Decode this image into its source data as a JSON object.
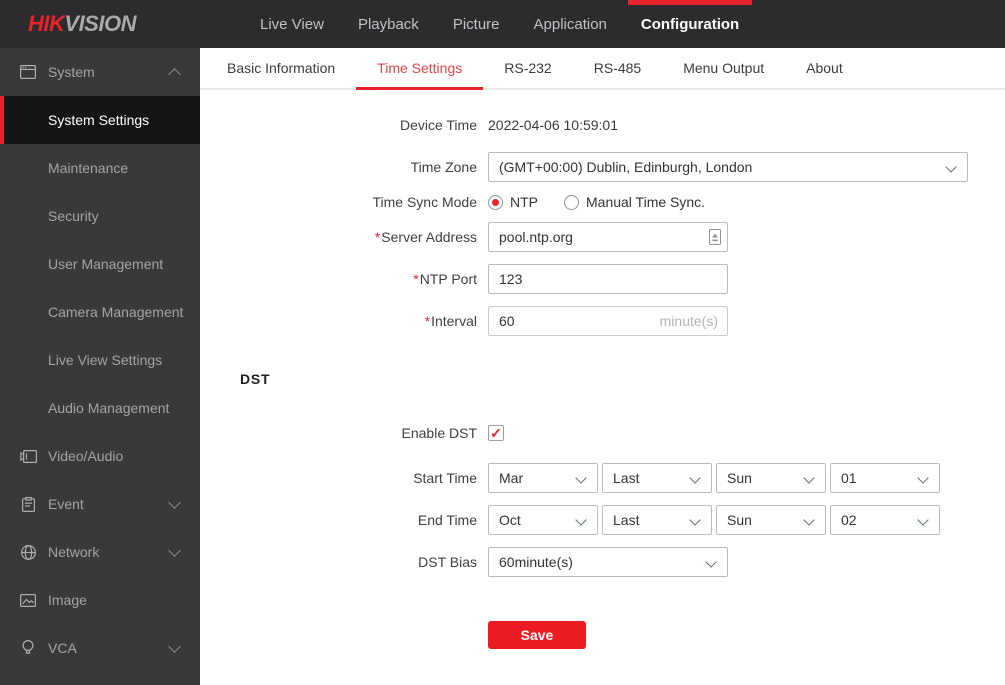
{
  "colors": {
    "accent_red": "#e8232b",
    "save_button_red": "#ed1c24",
    "topbar_bg": "#2c2c2e",
    "sidebar_bg": "#39393b",
    "active_sidebar_bg": "#151515",
    "active_tab_text": "#e24343"
  },
  "topbar": {
    "logo_hik": "HIK",
    "logo_vision": "VISION",
    "nav": [
      {
        "label": "Live View"
      },
      {
        "label": "Playback"
      },
      {
        "label": "Picture"
      },
      {
        "label": "Application"
      },
      {
        "label": "Configuration",
        "active": true
      }
    ]
  },
  "sidebar": {
    "items": [
      {
        "label": "System",
        "type": "group",
        "icon": "system-icon",
        "chevron": "up",
        "expanded": true
      },
      {
        "label": "System Settings",
        "type": "sub",
        "active": true
      },
      {
        "label": "Maintenance",
        "type": "sub"
      },
      {
        "label": "Security",
        "type": "sub"
      },
      {
        "label": "User Management",
        "type": "sub"
      },
      {
        "label": "Camera Management",
        "type": "sub"
      },
      {
        "label": "Live View Settings",
        "type": "sub"
      },
      {
        "label": "Audio Management",
        "type": "sub"
      },
      {
        "label": "Video/Audio",
        "type": "group",
        "icon": "video-audio-icon"
      },
      {
        "label": "Event",
        "type": "group",
        "icon": "event-icon",
        "chevron": "down"
      },
      {
        "label": "Network",
        "type": "group",
        "icon": "network-icon",
        "chevron": "down"
      },
      {
        "label": "Image",
        "type": "group",
        "icon": "image-icon"
      },
      {
        "label": "VCA",
        "type": "group",
        "icon": "vca-icon",
        "chevron": "down"
      }
    ]
  },
  "tabs": [
    {
      "label": "Basic Information"
    },
    {
      "label": "Time Settings",
      "active": true
    },
    {
      "label": "RS-232"
    },
    {
      "label": "RS-485"
    },
    {
      "label": "Menu Output"
    },
    {
      "label": "About"
    }
  ],
  "form": {
    "device_time": {
      "label": "Device Time",
      "value": "2022-04-06 10:59:01"
    },
    "time_zone": {
      "label": "Time Zone",
      "value": "(GMT+00:00) Dublin, Edinburgh, London"
    },
    "time_sync_mode": {
      "label": "Time Sync Mode",
      "options": [
        {
          "label": "NTP",
          "selected": true
        },
        {
          "label": "Manual Time Sync.",
          "selected": false
        }
      ]
    },
    "server_address": {
      "label": "Server Address",
      "required": "*",
      "value": "pool.ntp.org"
    },
    "ntp_port": {
      "label": "NTP Port",
      "required": "*",
      "value": "123"
    },
    "interval": {
      "label": "Interval",
      "required": "*",
      "value": "60",
      "suffix": "minute(s)"
    },
    "dst_heading": "DST",
    "enable_dst": {
      "label": "Enable DST",
      "checked": true
    },
    "start_time": {
      "label": "Start Time",
      "values": [
        "Mar",
        "Last",
        "Sun",
        "01"
      ]
    },
    "end_time": {
      "label": "End Time",
      "values": [
        "Oct",
        "Last",
        "Sun",
        "02"
      ]
    },
    "dst_bias": {
      "label": "DST Bias",
      "value": "60minute(s)"
    },
    "save_label": "Save"
  }
}
